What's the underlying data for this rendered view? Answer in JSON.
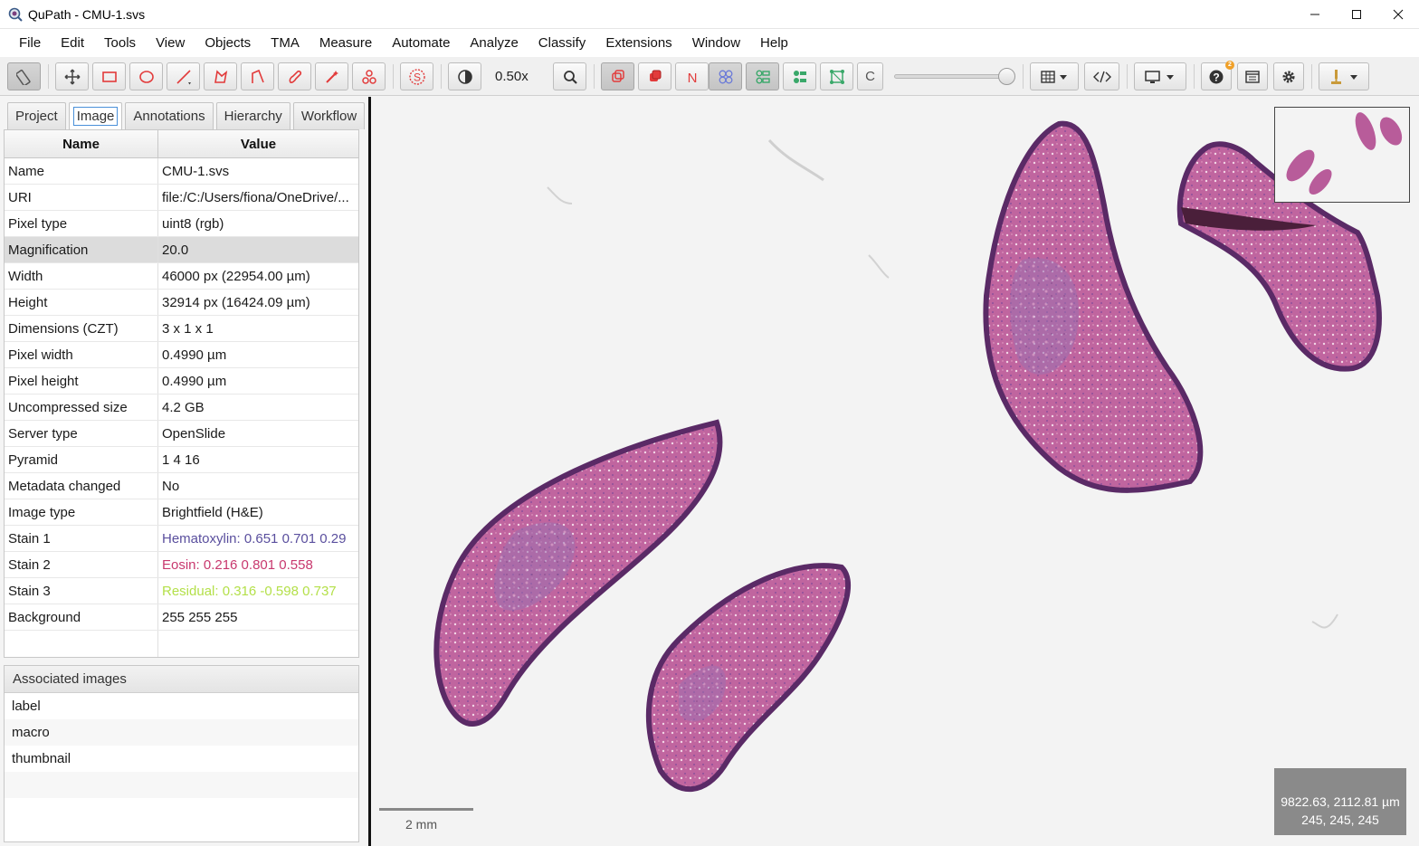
{
  "window": {
    "title": "QuPath - CMU-1.svs"
  },
  "menu": [
    "File",
    "Edit",
    "Tools",
    "View",
    "Objects",
    "TMA",
    "Measure",
    "Automate",
    "Analyze",
    "Classify",
    "Extensions",
    "Window",
    "Help"
  ],
  "toolbar": {
    "zoom_label": "0.50x",
    "classification_button": "C"
  },
  "tabs": [
    "Project",
    "Image",
    "Annotations",
    "Hierarchy",
    "Workflow"
  ],
  "active_tab": "Image",
  "properties": {
    "header_name": "Name",
    "header_value": "Value",
    "rows": [
      {
        "key": "Name",
        "value": "CMU-1.svs"
      },
      {
        "key": "URI",
        "value": "file:/C:/Users/fiona/OneDrive/..."
      },
      {
        "key": "Pixel type",
        "value": "uint8 (rgb)"
      },
      {
        "key": "Magnification",
        "value": "20.0"
      },
      {
        "key": "Width",
        "value": "46000 px (22954.00 µm)"
      },
      {
        "key": "Height",
        "value": "32914 px (16424.09 µm)"
      },
      {
        "key": "Dimensions (CZT)",
        "value": "3 x 1 x 1"
      },
      {
        "key": "Pixel width",
        "value": "0.4990 µm"
      },
      {
        "key": "Pixel height",
        "value": "0.4990 µm"
      },
      {
        "key": "Uncompressed size",
        "value": "4.2 GB"
      },
      {
        "key": "Server type",
        "value": "OpenSlide"
      },
      {
        "key": "Pyramid",
        "value": "1 4 16"
      },
      {
        "key": "Metadata changed",
        "value": "No"
      },
      {
        "key": "Image type",
        "value": "Brightfield (H&E)"
      },
      {
        "key": "Stain 1",
        "value": "Hematoxylin: 0.651 0.701 0.29",
        "color": "#5a4f9e"
      },
      {
        "key": "Stain 2",
        "value": "Eosin: 0.216 0.801 0.558",
        "color": "#c8386e"
      },
      {
        "key": "Stain 3",
        "value": "Residual: 0.316 -0.598 0.737",
        "color": "#b4e04a"
      },
      {
        "key": "Background",
        "value": "255 255 255"
      }
    ]
  },
  "associated_images": {
    "header": "Associated images",
    "items": [
      "label",
      "macro",
      "thumbnail"
    ]
  },
  "viewer": {
    "scalebar_label": "2 mm",
    "cursor_position": "9822.63, 2112.81 µm",
    "cursor_rgb": "245, 245, 245"
  },
  "notification_count": "2",
  "colors": {
    "tissue": "#b85c9a",
    "tissue_edge": "#5a2a66",
    "toolbar_red": "#e23b3b",
    "toolbar_green": "#3aa86a"
  }
}
